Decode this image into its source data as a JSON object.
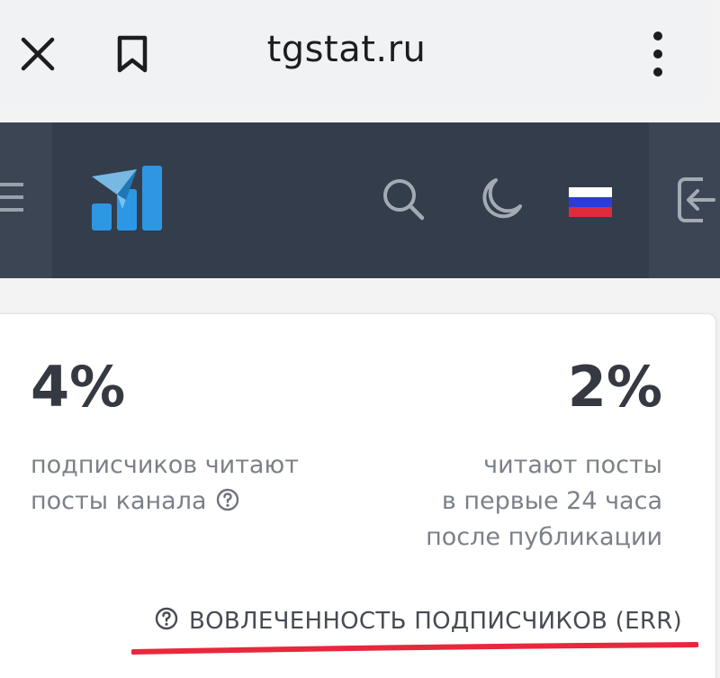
{
  "browser": {
    "url": "tgstat.ru",
    "icons": [
      "close-icon",
      "bookmark-icon",
      "more-vert-icon"
    ]
  },
  "header": {
    "icons": [
      "hamburger-icon",
      "tgstat-logo-icon",
      "search-icon",
      "moon-icon",
      "russia-flag-icon",
      "login-icon"
    ],
    "logo_color": "#2d97e4",
    "background": "#343d4c"
  },
  "stats": {
    "left": {
      "value": "4%",
      "line1": "подписчиков читают",
      "line2": "посты канала"
    },
    "right": {
      "value": "2%",
      "line1": "читают посты",
      "line2": "в первые 24 часа",
      "line3": "после публикации"
    },
    "err_label": "ВОВЛЕЧЕННОСТЬ ПОДПИСЧИКОВ (ERR)",
    "underline_color": "#e8283c"
  }
}
